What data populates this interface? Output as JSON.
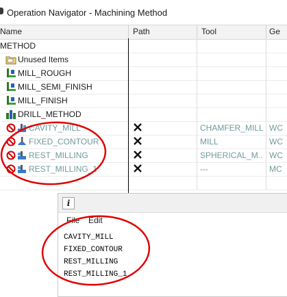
{
  "window": {
    "title": "Operation Navigator - Machining Method"
  },
  "columns": {
    "name": "Name",
    "path": "Path",
    "tool": "Tool",
    "geometry": "Ge"
  },
  "rows": [
    {
      "name": "METHOD",
      "tool": "",
      "geo": "",
      "icon": "method-icon"
    },
    {
      "name": "Unused Items",
      "tool": "",
      "geo": "",
      "icon": "folder-icon"
    },
    {
      "name": "MILL_ROUGH",
      "tool": "",
      "geo": "",
      "icon": "mill-method-icon"
    },
    {
      "name": "MILL_SEMI_FINISH",
      "tool": "",
      "geo": "",
      "icon": "mill-method-icon"
    },
    {
      "name": "MILL_FINISH",
      "tool": "",
      "geo": "",
      "icon": "mill-method-icon"
    },
    {
      "name": "DRILL_METHOD",
      "tool": "",
      "geo": "",
      "icon": "drill-method-icon"
    },
    {
      "name": "CAVITY_MILL",
      "tool": "CHAMFER_MILL",
      "geo": "WC",
      "icon": "cavity-mill-icon",
      "status": "no-entry-icon",
      "path": "x-icon"
    },
    {
      "name": "FIXED_CONTOUR",
      "tool": "MILL",
      "geo": "WC",
      "icon": "fixed-contour-icon",
      "status": "no-entry-icon",
      "path": "x-icon"
    },
    {
      "name": "REST_MILLING",
      "tool": "SPHERICAL_M...",
      "geo": "WC",
      "icon": "rest-milling-icon",
      "status": "no-entry-icon",
      "path": "x-icon"
    },
    {
      "name": "REST_MILLING_1",
      "tool": "---",
      "geo": "MC",
      "icon": "rest-milling-icon",
      "status": "no-entry-icon",
      "path": "x-icon"
    }
  ],
  "dialog": {
    "icon": "i",
    "menu": {
      "file": "File",
      "edit": "Edit"
    },
    "lines": [
      "CAVITY_MILL",
      "FIXED_CONTOUR",
      "REST_MILLING",
      "REST_MILLING_1"
    ]
  },
  "colors": {
    "greyed_text": "#6e9a9a",
    "annotation": "#e00000",
    "no_entry": "#d40000"
  }
}
